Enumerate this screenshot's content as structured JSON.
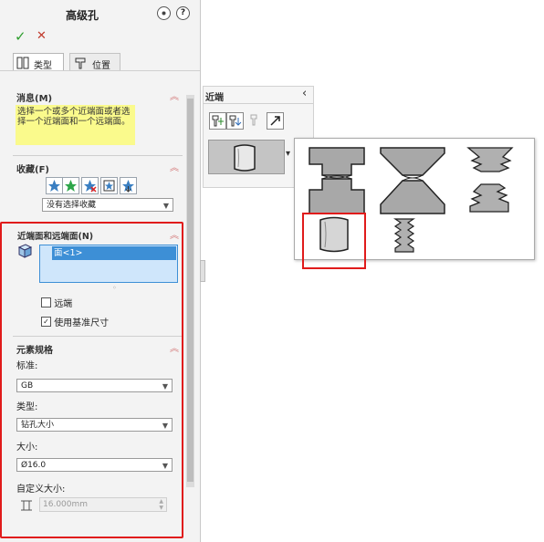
{
  "pm": {
    "title": "高级孔",
    "help_glyph": "?",
    "ok_glyph": "✓",
    "cancel_glyph": "✕",
    "tabs": [
      {
        "label": "类型"
      },
      {
        "label": "位置"
      }
    ],
    "message": {
      "title": "消息(M)",
      "text": "选择一个或多个近端面或者选择一个近端面和一个远端面。"
    },
    "favorites": {
      "title": "收藏(F)",
      "select_value": "没有选择收藏"
    },
    "faces": {
      "title": "近端面和远端面(N)",
      "list_item": "面<1>",
      "far_end_label": "远端",
      "use_std_label": "使用基准尺寸",
      "use_std_checked": true,
      "far_end_checked": false
    },
    "spec": {
      "title": "元素规格",
      "standard_label": "标准:",
      "standard_value": "GB",
      "type_label": "类型:",
      "type_value": "钻孔大小",
      "size_label": "大小:",
      "size_value": "Ø16.0",
      "custom_label": "自定义大小:",
      "custom_value": "16.000mm"
    }
  },
  "flyout": {
    "title": "近端",
    "collapse_glyph": "‹",
    "dropdown_glyph": "▾"
  },
  "colors": {
    "message_bg": "#fafa8c",
    "highlight": "#e01b1b",
    "selection": "#3d8fd6",
    "check": "#2e9e2e",
    "cancel": "#c0392b"
  }
}
